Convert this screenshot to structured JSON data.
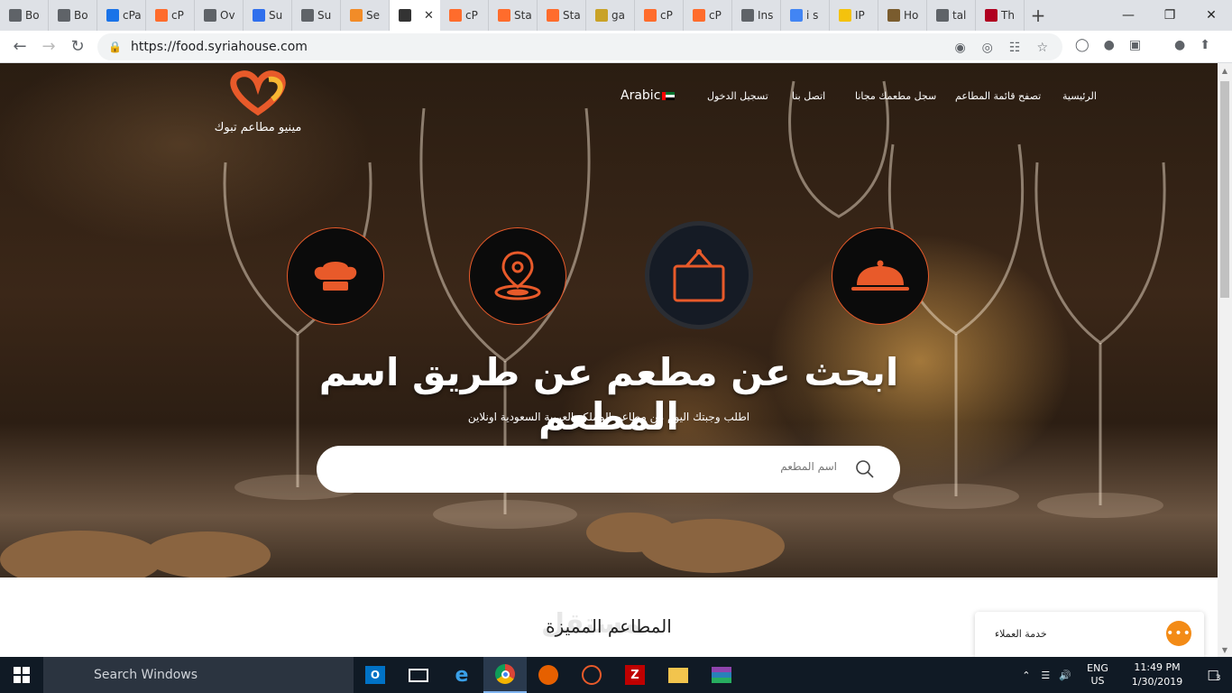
{
  "browser": {
    "tabs": [
      {
        "label": "Bo",
        "icon": "doc-icon",
        "color": "#5f6368"
      },
      {
        "label": "Bo",
        "icon": "doc-icon",
        "color": "#5f6368"
      },
      {
        "label": "cPa",
        "icon": "blue-app-icon",
        "color": "#1a73e8"
      },
      {
        "label": "cP",
        "icon": "cpanel-icon",
        "color": "#ff6c2c"
      },
      {
        "label": "Ov",
        "icon": "cloud-icon",
        "color": "#5f6368"
      },
      {
        "label": "Su",
        "icon": "blue-n-icon",
        "color": "#2f6fed"
      },
      {
        "label": "Su",
        "icon": "doc-icon",
        "color": "#5f6368"
      },
      {
        "label": "Se",
        "icon": "orange-house-icon",
        "color": "#f28c28"
      },
      {
        "label": "",
        "icon": "current-site-icon",
        "color": "#333333",
        "active": true
      },
      {
        "label": "cP",
        "icon": "cpanel-icon",
        "color": "#ff6c2c"
      },
      {
        "label": "Sta",
        "icon": "cpanel-icon",
        "color": "#ff6c2c"
      },
      {
        "label": "Sta",
        "icon": "cpanel-icon",
        "color": "#ff6c2c"
      },
      {
        "label": "ga",
        "icon": "gold-icon",
        "color": "#c9a227"
      },
      {
        "label": "cP",
        "icon": "cpanel-icon",
        "color": "#ff6c2c"
      },
      {
        "label": "cP",
        "icon": "cpanel-icon",
        "color": "#ff6c2c"
      },
      {
        "label": "Ins",
        "icon": "doc-icon",
        "color": "#5f6368"
      },
      {
        "label": "i s",
        "icon": "google-icon",
        "color": "#4285f4"
      },
      {
        "label": "IP",
        "icon": "yellow-search-icon",
        "color": "#f4c20d"
      },
      {
        "label": "Ho",
        "icon": "feather-icon",
        "color": "#7a5c2e"
      },
      {
        "label": "tal",
        "icon": "doc-icon",
        "color": "#5f6368"
      },
      {
        "label": "Th",
        "icon": "grid-icon",
        "color": "#b00020"
      }
    ],
    "url": "https://food.syriahouse.com"
  },
  "site": {
    "logo_text": "مينيو مطاعم تبوك",
    "nav": {
      "home": "الرئيسية",
      "browse": "تصفح قائمة المطاعم",
      "register_restaurant": "سجل مطعمك مجانا",
      "contact": "اتصل بنا",
      "login": "تسجيل الدخول",
      "language": "Arabic"
    },
    "hero": {
      "headline": "ابحث عن مطعم عن طريق اسم المطعم",
      "subline": "اطلب وجبتك اليوم من مطاعم المملكة العربية السعودية اونلاين",
      "search_placeholder": "اسم المطعم"
    },
    "featured_title": "المطاعم المميزة",
    "chat_label": "خدمة العملاء",
    "watermark": "مستقل",
    "accent_color": "#e85a2a"
  },
  "taskbar": {
    "search_placeholder": "Search Windows",
    "lang_line1": "ENG",
    "lang_line2": "US",
    "time": "11:49 PM",
    "date": "1/30/2019",
    "notifications": "3"
  }
}
